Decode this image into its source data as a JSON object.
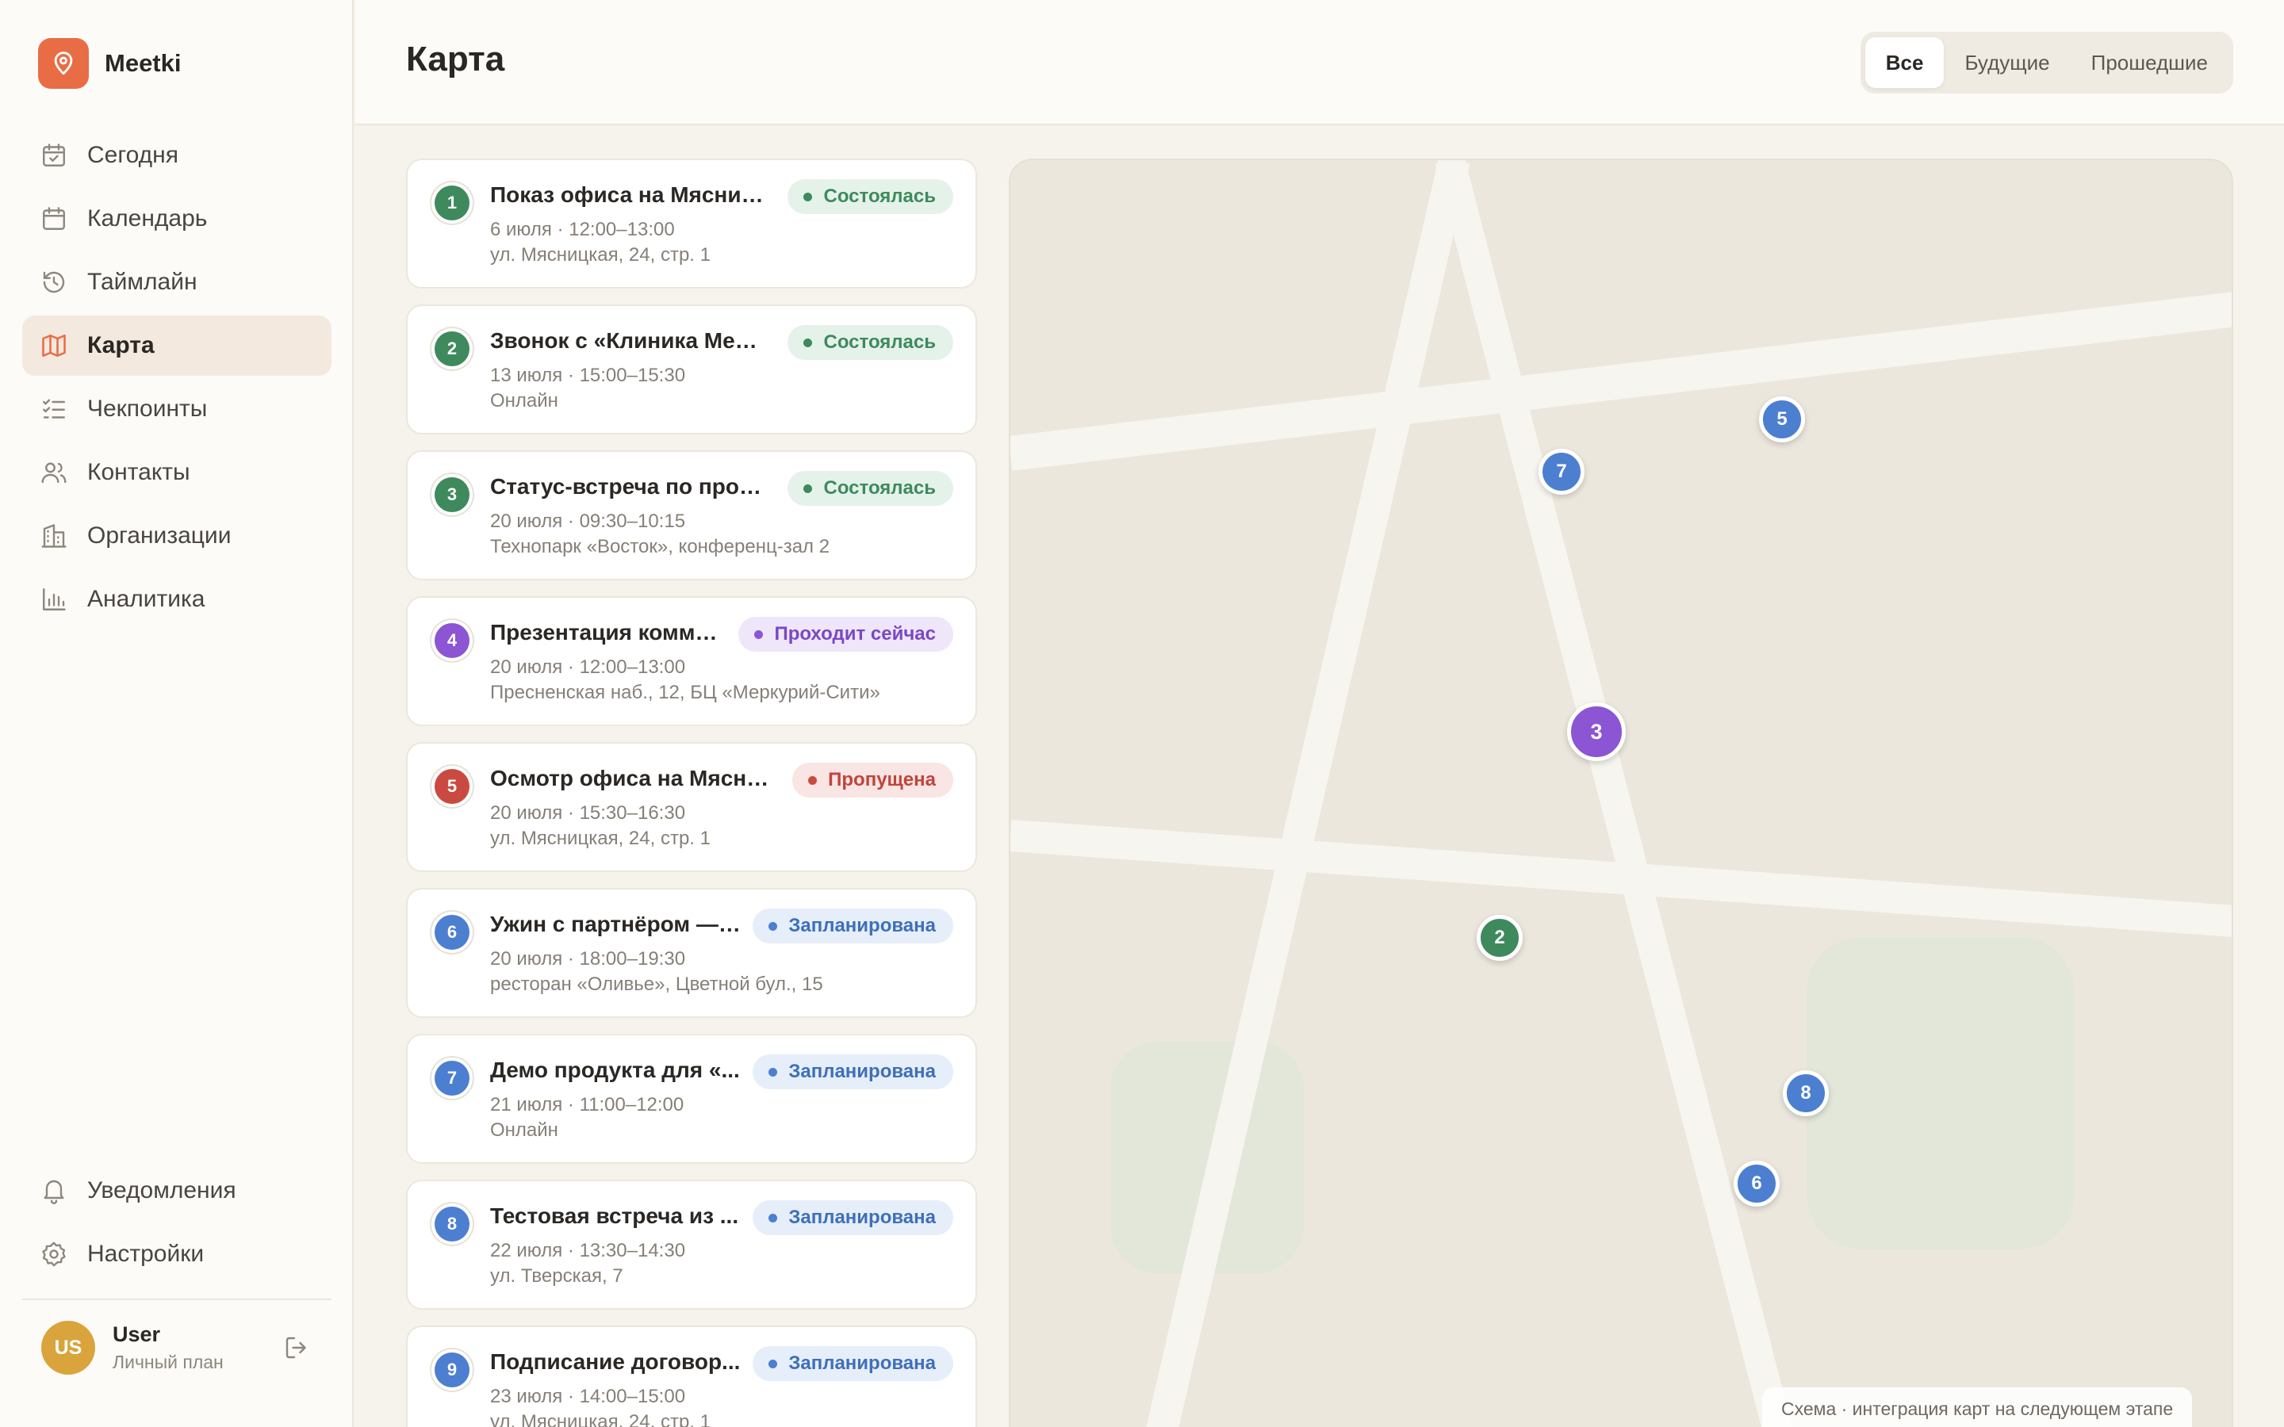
{
  "app": {
    "name": "Meetki",
    "logo_icon": "map-pin-icon",
    "accent": "#e96d44"
  },
  "sidebar": {
    "items": [
      {
        "label": "Сегодня",
        "icon": "calendar-check-icon"
      },
      {
        "label": "Календарь",
        "icon": "calendar-icon"
      },
      {
        "label": "Таймлайн",
        "icon": "history-icon"
      },
      {
        "label": "Карта",
        "icon": "map-icon",
        "active": true
      },
      {
        "label": "Чекпоинты",
        "icon": "checklist-icon"
      },
      {
        "label": "Контакты",
        "icon": "users-icon"
      },
      {
        "label": "Организации",
        "icon": "building-icon"
      },
      {
        "label": "Аналитика",
        "icon": "bar-chart-icon"
      }
    ],
    "bottom_items": [
      {
        "label": "Уведомления",
        "icon": "bell-icon"
      },
      {
        "label": "Настройки",
        "icon": "gear-icon"
      }
    ],
    "user": {
      "initials": "US",
      "name": "User",
      "plan": "Личный план"
    }
  },
  "header": {
    "title": "Карта",
    "filters": [
      {
        "label": "Все",
        "active": true
      },
      {
        "label": "Будущие"
      },
      {
        "label": "Прошедшие"
      }
    ]
  },
  "status_colors": {
    "done": "#3e8a5d",
    "now": "#8b55d4",
    "missed": "#c94a40",
    "planned": "#4c7fd0"
  },
  "events": [
    {
      "num": "1",
      "title": "Показ офиса на Мясницк...",
      "time": "6 июля · 12:00–13:00",
      "place": "ул. Мясницкая, 24, стр. 1",
      "status": "Состоялась",
      "kind": "done"
    },
    {
      "num": "2",
      "title": "Звонок с «Клиника Мед+»",
      "time": "13 июля · 15:00–15:30",
      "place": "Онлайн",
      "status": "Состоялась",
      "kind": "done"
    },
    {
      "num": "3",
      "title": "Статус-встреча по проек...",
      "time": "20 июля · 09:30–10:15",
      "place": "Технопарк «Восток», конференц-зал 2",
      "status": "Состоялась",
      "kind": "done"
    },
    {
      "num": "4",
      "title": "Презентация комме...",
      "time": "20 июля · 12:00–13:00",
      "place": "Пресненская наб., 12, БЦ «Меркурий-Сити»",
      "status": "Проходит сейчас",
      "kind": "now"
    },
    {
      "num": "5",
      "title": "Осмотр офиса на Мясниц...",
      "time": "20 июля · 15:30–16:30",
      "place": "ул. Мясницкая, 24, стр. 1",
      "status": "Пропущена",
      "kind": "missed"
    },
    {
      "num": "6",
      "title": "Ужин с партнёром — о...",
      "time": "20 июля · 18:00–19:30",
      "place": "ресторан «Оливье», Цветной бул., 15",
      "status": "Запланирована",
      "kind": "planned"
    },
    {
      "num": "7",
      "title": "Демо продукта для «...",
      "time": "21 июля · 11:00–12:00",
      "place": "Онлайн",
      "status": "Запланирована",
      "kind": "planned"
    },
    {
      "num": "8",
      "title": "Тестовая встреча из ...",
      "time": "22 июля · 13:30–14:30",
      "place": "ул. Тверская, 7",
      "status": "Запланирована",
      "kind": "planned"
    },
    {
      "num": "9",
      "title": "Подписание договор...",
      "time": "23 июля · 14:00–15:00",
      "place": "ул. Мясницкая, 24, стр. 1",
      "status": "Запланирована",
      "kind": "planned"
    }
  ],
  "map": {
    "pins": [
      {
        "label": "5",
        "kind": "planned"
      },
      {
        "label": "7",
        "kind": "planned"
      },
      {
        "label": "3",
        "kind": "now"
      },
      {
        "label": "2",
        "kind": "done"
      },
      {
        "label": "8",
        "kind": "planned"
      },
      {
        "label": "6",
        "kind": "planned"
      }
    ],
    "caption": "Схема · интеграция карт на следующем этапе"
  }
}
